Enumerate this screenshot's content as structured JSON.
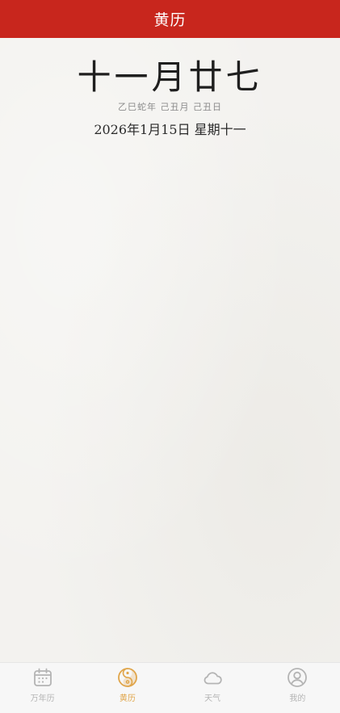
{
  "header": {
    "title": "黄历"
  },
  "main": {
    "lunar_date": "十一月廿七",
    "ganzhi": "乙巳蛇年 己丑月 己丑日",
    "solar_date": "2026年1月15日 星期十一"
  },
  "tabbar": {
    "active_index": 1,
    "active_color": "#e0a54a",
    "inactive_color": "#b4b4b4",
    "items": [
      {
        "label": "万年历",
        "icon": "calendar-icon"
      },
      {
        "label": "黄历",
        "icon": "yin-yang-icon"
      },
      {
        "label": "天气",
        "icon": "cloud-icon"
      },
      {
        "label": "我的",
        "icon": "user-icon"
      }
    ]
  },
  "colors": {
    "header_bg": "#c8261d",
    "page_bg": "#f3f2ef"
  }
}
